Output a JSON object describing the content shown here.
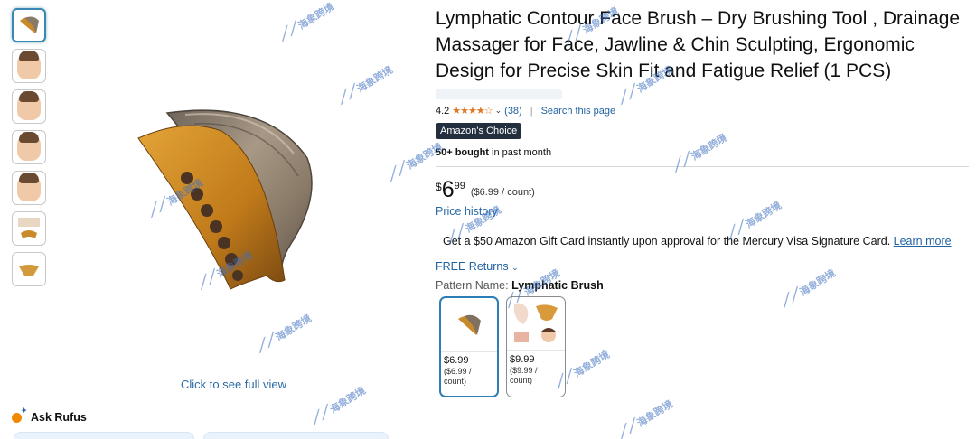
{
  "product": {
    "title": "Lymphatic Contour Face Brush – Dry Brushing Tool , Drainage Massager for Face, Jawline & Chin Sculpting, Ergonomic Design for Precise Skin Fit and Fatigue Relief (1 PCS)",
    "rating": "4.2",
    "stars": "★★★★☆",
    "review_count": "(38)",
    "search_page": "Search this page",
    "badge": "Amazon's Choice",
    "bought_bold": "50+ bought",
    "bought_rest": "in past month",
    "price": {
      "currency": "$",
      "whole": "6",
      "fraction": "99",
      "unit": "($6.99 / count)"
    },
    "price_history": "Price history",
    "promo_text": "Get a $50 Amazon Gift Card instantly upon approval for the Mercury Visa Signature Card.",
    "promo_link": "Learn more",
    "returns": "FREE Returns",
    "pattern_label": "Pattern Name:",
    "pattern_value": "Lymphatic Brush",
    "swatches": [
      {
        "price": "$6.99",
        "unit": "($6.99 / count)"
      },
      {
        "price": "$9.99",
        "unit": "($9.99 / count)"
      }
    ]
  },
  "gallery": {
    "see_full_view": "Click to see full view",
    "ask_rufus": "Ask Rufus"
  },
  "watermark": {
    "text": "海象跨境"
  },
  "colors": {
    "link": "#2162a1",
    "badge_bg": "#232f3e",
    "star": "#de7921",
    "selected_border": "#2c7fb6"
  }
}
